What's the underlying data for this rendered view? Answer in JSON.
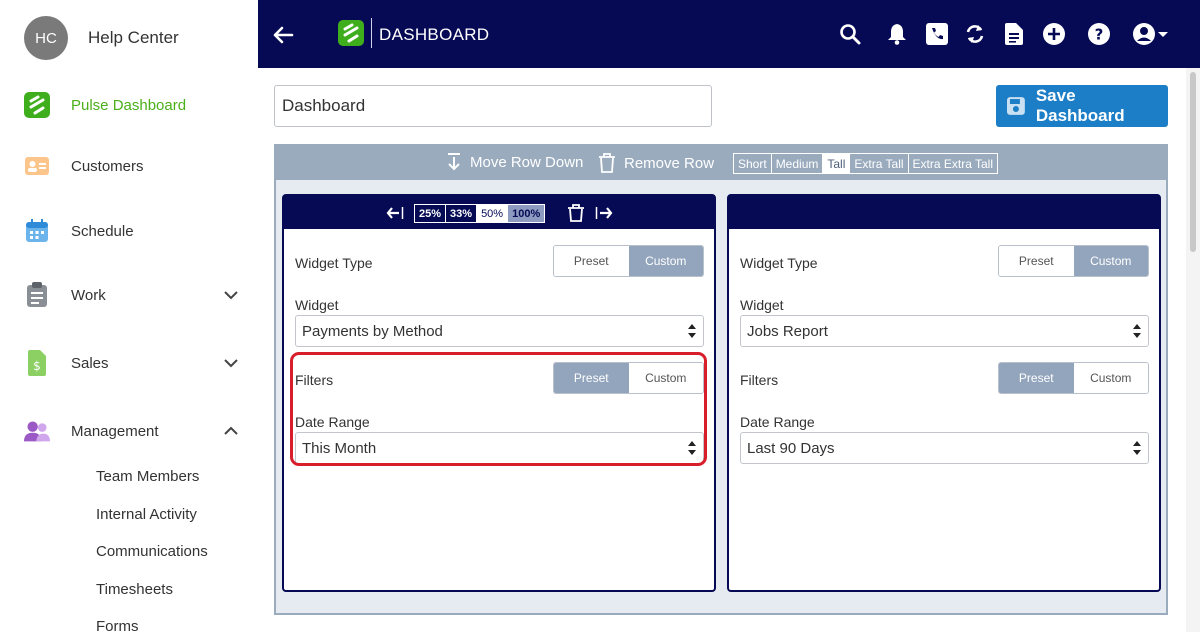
{
  "sidebar": {
    "user": {
      "initials": "HC",
      "name": "Help Center"
    },
    "items": [
      {
        "label": "Pulse Dashboard",
        "active": true
      },
      {
        "label": "Customers"
      },
      {
        "label": "Schedule"
      },
      {
        "label": "Work",
        "expandable": true
      },
      {
        "label": "Sales",
        "expandable": true
      },
      {
        "label": "Management",
        "expanded": true
      }
    ],
    "sub_items": [
      "Team Members",
      "Internal Activity",
      "Communications",
      "Timesheets",
      "Forms"
    ]
  },
  "topbar": {
    "title": "DASHBOARD",
    "icons": [
      "back-arrow-icon",
      "search-icon",
      "bell-icon",
      "phone-icon",
      "refresh-icon",
      "document-icon",
      "add-icon",
      "help-icon",
      "account-icon"
    ]
  },
  "main": {
    "dashboard_name": "Dashboard",
    "save_label": "Save Dashboard",
    "row_toolbar": {
      "move_down": "Move Row Down",
      "remove_row": "Remove Row",
      "sizes": [
        "Short",
        "Medium",
        "Tall",
        "Extra Tall",
        "Extra Extra Tall"
      ],
      "selected_size": "Tall"
    },
    "widgets": [
      {
        "widths": [
          "25%",
          "33%",
          "50%",
          "100%"
        ],
        "selected_width": "50%",
        "widget_type_label": "Widget Type",
        "widget_type_options": [
          "Preset",
          "Custom"
        ],
        "widget_type_selected": "Custom",
        "widget_label": "Widget",
        "widget_value": "Payments by Method",
        "filters_label": "Filters",
        "filters_options": [
          "Preset",
          "Custom"
        ],
        "filters_selected": "Preset",
        "date_range_label": "Date Range",
        "date_range_value": "This Month"
      },
      {
        "widget_type_label": "Widget Type",
        "widget_type_options": [
          "Preset",
          "Custom"
        ],
        "widget_type_selected": "Custom",
        "widget_label": "Widget",
        "widget_value": "Jobs Report",
        "filters_label": "Filters",
        "filters_options": [
          "Preset",
          "Custom"
        ],
        "filters_selected": "Preset",
        "date_range_label": "Date Range",
        "date_range_value": "Last 90 Days"
      }
    ]
  },
  "colors": {
    "navy": "#060a54",
    "accent_green": "#4caf1a",
    "save_blue": "#1b7ec6",
    "toolbar_gray": "#9aabbe",
    "highlight_red": "#d81e2b"
  }
}
